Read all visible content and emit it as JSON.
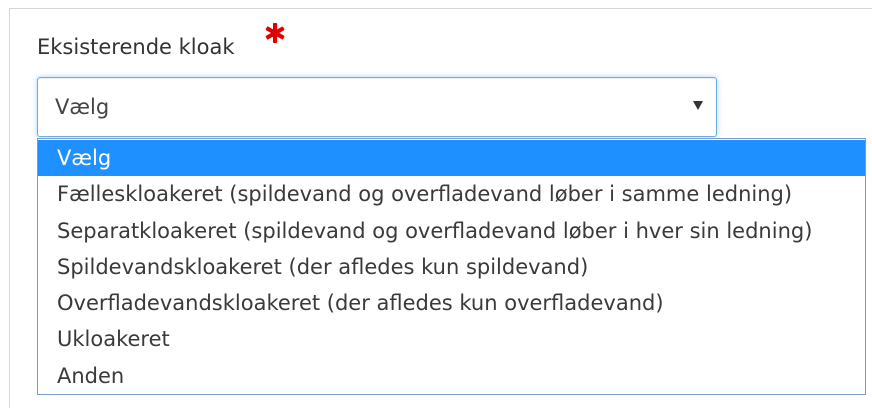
{
  "form": {
    "field_label": "Eksisterende kloak",
    "required_marker": "*",
    "required_color": "#e00000",
    "accent_color": "#1e90ff",
    "select": {
      "selected_value": "Vælg",
      "options": [
        "Vælg",
        "Fælleskloakeret (spildevand og overfladevand løber i samme ledning)",
        "Separatkloakeret (spildevand og overfladevand løber i hver sin ledning)",
        "Spildevandskloakeret (der afledes kun spildevand)",
        "Overfladevandskloakeret (der afledes kun overfladevand)",
        "Ukloakeret",
        "Anden"
      ],
      "highlighted_index": 0
    }
  }
}
